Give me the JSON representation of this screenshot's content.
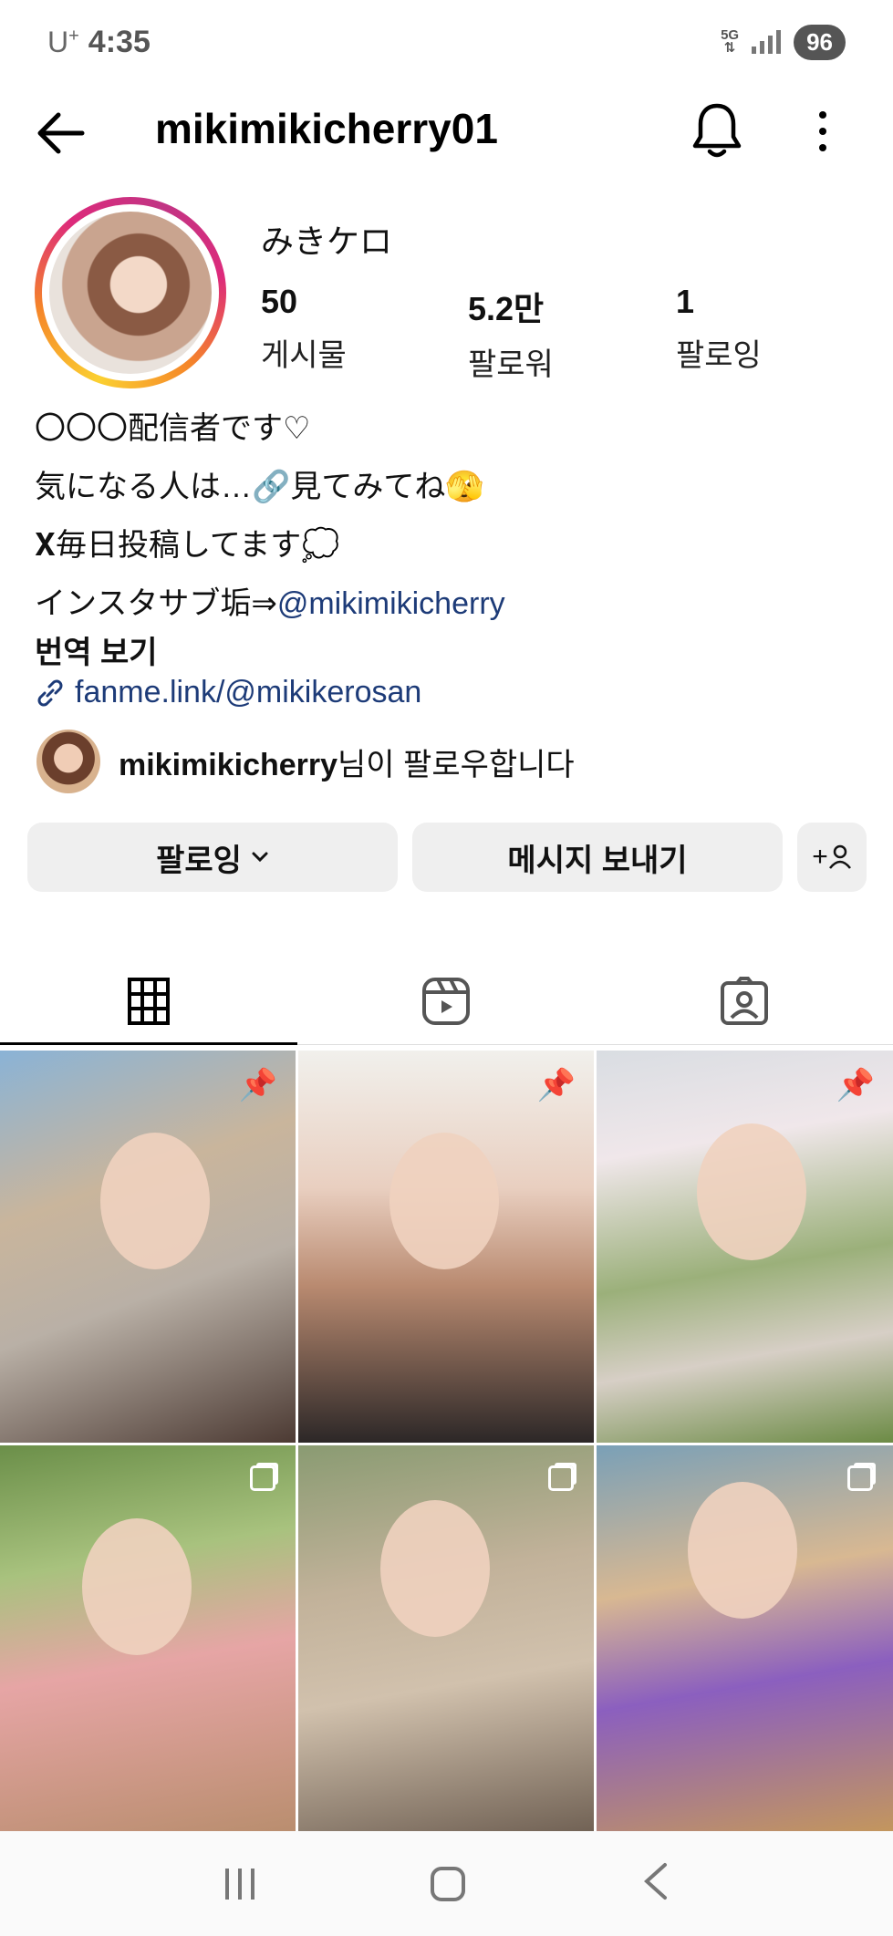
{
  "status_bar": {
    "carrier": "U",
    "carrier_sup": "+",
    "time": "4:35",
    "network": "5G",
    "battery": "96"
  },
  "header": {
    "username": "mikimikicherry01",
    "icons": [
      "back-arrow-icon",
      "bell-icon",
      "more-vertical-icon"
    ]
  },
  "profile": {
    "display_name": "みきケロ",
    "stats": [
      {
        "value": "50",
        "label": "게시물"
      },
      {
        "value": "5.2만",
        "label": "팔로워"
      },
      {
        "value": "1",
        "label": "팔로잉"
      }
    ],
    "bio_lines": [
      "〇〇〇配信者です♡",
      "気になる人は…🔗見てみてね🫣",
      "𝐗毎日投稿してます💭"
    ],
    "bio_last_prefix": "インスタサブ垢⇒",
    "bio_last_mention": "@mikimikicherry",
    "translate": "번역 보기",
    "link": "fanme.link/@mikikerosan",
    "followed_by_name": "mikimikicherry",
    "followed_by_suffix": "님이 팔로우합니다"
  },
  "actions": {
    "following_label": "팔로잉",
    "message_label": "메시지 보내기",
    "add_label": "+"
  },
  "tabs": [
    "grid-icon",
    "reels-icon",
    "tagged-icon"
  ],
  "grid": [
    {
      "badge": "pin"
    },
    {
      "badge": "pin"
    },
    {
      "badge": "pin"
    },
    {
      "badge": "multi"
    },
    {
      "badge": "multi"
    },
    {
      "badge": "multi"
    }
  ]
}
